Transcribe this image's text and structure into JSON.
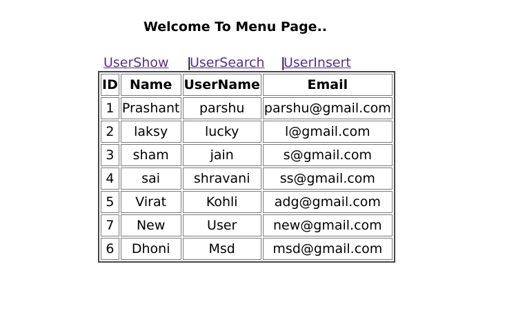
{
  "page": {
    "title": "Welcome To Menu Page.."
  },
  "nav": {
    "links": [
      {
        "label": "UserShow"
      },
      {
        "label": "UserSearch"
      },
      {
        "label": "UserInsert"
      }
    ],
    "separator": "|",
    "link_color": "#5a2d8c"
  },
  "table": {
    "headers": [
      "ID",
      "Name",
      "UserName",
      "Email"
    ],
    "rows": [
      [
        "1",
        "Prashant",
        "parshu",
        "parshu@gmail.com"
      ],
      [
        "2",
        "laksy",
        "lucky",
        "l@gmail.com"
      ],
      [
        "3",
        "sham",
        "jain",
        "s@gmail.com"
      ],
      [
        "4",
        "sai",
        "shravani",
        "ss@gmail.com"
      ],
      [
        "5",
        "Virat",
        "Kohli",
        "adg@gmail.com"
      ],
      [
        "7",
        "New",
        "User",
        "new@gmail.com"
      ],
      [
        "6",
        "Dhoni",
        "Msd",
        "msd@gmail.com"
      ]
    ]
  }
}
